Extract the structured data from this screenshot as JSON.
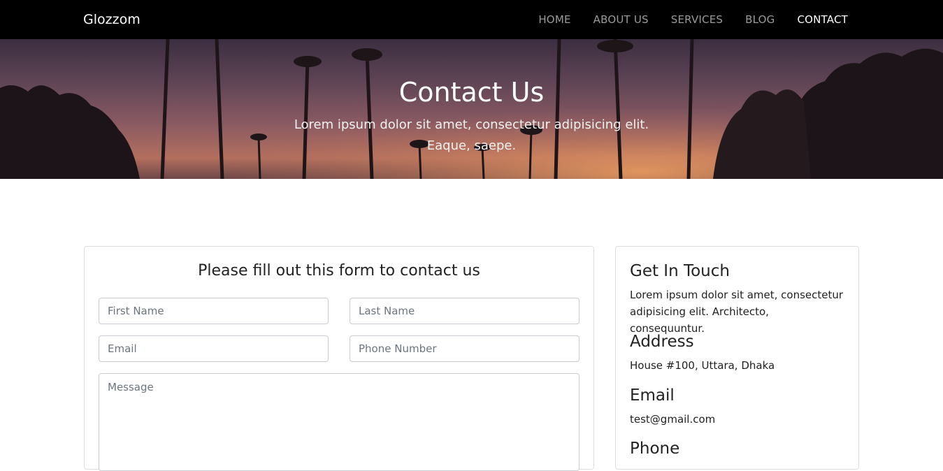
{
  "navbar": {
    "brand": "Glozzom",
    "links": [
      {
        "label": "HOME",
        "active": false
      },
      {
        "label": "ABOUT US",
        "active": false
      },
      {
        "label": "SERVICES",
        "active": false
      },
      {
        "label": "BLOG",
        "active": false
      },
      {
        "label": "CONTACT",
        "active": true
      }
    ]
  },
  "hero": {
    "title": "Contact Us",
    "subtitle": "Lorem ipsum dolor sit amet, consectetur adipisicing elit. Eaque, saepe."
  },
  "form": {
    "title": "Please fill out this form to contact us",
    "first_name_placeholder": "First Name",
    "last_name_placeholder": "Last Name",
    "email_placeholder": "Email",
    "phone_placeholder": "Phone Number",
    "message_placeholder": "Message"
  },
  "info": {
    "get_in_touch_title": "Get In Touch",
    "get_in_touch_text": "Lorem ipsum dolor sit amet, consectetur adipisicing elit. Architecto, consequuntur.",
    "address_title": "Address",
    "address_text": "House #100, Uttara, Dhaka",
    "email_title": "Email",
    "email_text": "test@gmail.com",
    "phone_title": "Phone"
  },
  "colors": {
    "navbar_bg": "#000000",
    "nav_link": "#9a9a9a",
    "nav_active": "#ffffff",
    "card_border": "#dcdcdc"
  }
}
